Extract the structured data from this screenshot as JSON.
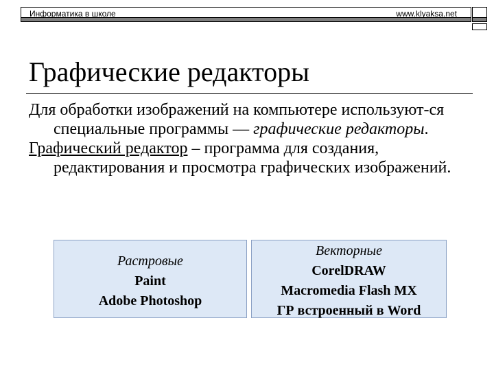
{
  "header": {
    "left_text": "Информатика в школе",
    "right_link": "www.klyaksa.net"
  },
  "title": "Графические редакторы",
  "body": {
    "p1_start": "Для обработки изображений на компьютере используют-ся специальные программы — ",
    "p1_emph": "графические редакторы",
    "p1_end": ".",
    "p2_term": "Графический редактор",
    "p2_rest": " – программа для создания, редактирования и просмотра графических изображений."
  },
  "boxes": [
    {
      "heading": "Растровые",
      "items": [
        "Paint",
        "Adobe Photoshop"
      ]
    },
    {
      "heading": "Векторные",
      "items": [
        "CorelDRAW",
        "Macromedia Flash MX",
        "ГР встроенный в Word"
      ]
    }
  ]
}
